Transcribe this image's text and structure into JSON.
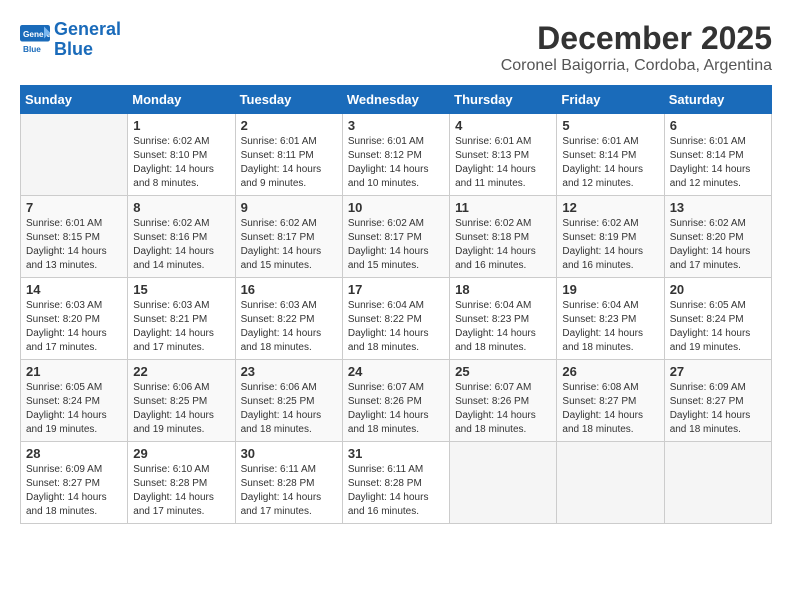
{
  "header": {
    "logo_line1": "General",
    "logo_line2": "Blue",
    "title": "December 2025",
    "subtitle": "Coronel Baigorria, Cordoba, Argentina"
  },
  "weekdays": [
    "Sunday",
    "Monday",
    "Tuesday",
    "Wednesday",
    "Thursday",
    "Friday",
    "Saturday"
  ],
  "weeks": [
    [
      {
        "day": "",
        "sunrise": "",
        "sunset": "",
        "daylight": ""
      },
      {
        "day": "1",
        "sunrise": "Sunrise: 6:02 AM",
        "sunset": "Sunset: 8:10 PM",
        "daylight": "Daylight: 14 hours and 8 minutes."
      },
      {
        "day": "2",
        "sunrise": "Sunrise: 6:01 AM",
        "sunset": "Sunset: 8:11 PM",
        "daylight": "Daylight: 14 hours and 9 minutes."
      },
      {
        "day": "3",
        "sunrise": "Sunrise: 6:01 AM",
        "sunset": "Sunset: 8:12 PM",
        "daylight": "Daylight: 14 hours and 10 minutes."
      },
      {
        "day": "4",
        "sunrise": "Sunrise: 6:01 AM",
        "sunset": "Sunset: 8:13 PM",
        "daylight": "Daylight: 14 hours and 11 minutes."
      },
      {
        "day": "5",
        "sunrise": "Sunrise: 6:01 AM",
        "sunset": "Sunset: 8:14 PM",
        "daylight": "Daylight: 14 hours and 12 minutes."
      },
      {
        "day": "6",
        "sunrise": "Sunrise: 6:01 AM",
        "sunset": "Sunset: 8:14 PM",
        "daylight": "Daylight: 14 hours and 12 minutes."
      }
    ],
    [
      {
        "day": "7",
        "sunrise": "Sunrise: 6:01 AM",
        "sunset": "Sunset: 8:15 PM",
        "daylight": "Daylight: 14 hours and 13 minutes."
      },
      {
        "day": "8",
        "sunrise": "Sunrise: 6:02 AM",
        "sunset": "Sunset: 8:16 PM",
        "daylight": "Daylight: 14 hours and 14 minutes."
      },
      {
        "day": "9",
        "sunrise": "Sunrise: 6:02 AM",
        "sunset": "Sunset: 8:17 PM",
        "daylight": "Daylight: 14 hours and 15 minutes."
      },
      {
        "day": "10",
        "sunrise": "Sunrise: 6:02 AM",
        "sunset": "Sunset: 8:17 PM",
        "daylight": "Daylight: 14 hours and 15 minutes."
      },
      {
        "day": "11",
        "sunrise": "Sunrise: 6:02 AM",
        "sunset": "Sunset: 8:18 PM",
        "daylight": "Daylight: 14 hours and 16 minutes."
      },
      {
        "day": "12",
        "sunrise": "Sunrise: 6:02 AM",
        "sunset": "Sunset: 8:19 PM",
        "daylight": "Daylight: 14 hours and 16 minutes."
      },
      {
        "day": "13",
        "sunrise": "Sunrise: 6:02 AM",
        "sunset": "Sunset: 8:20 PM",
        "daylight": "Daylight: 14 hours and 17 minutes."
      }
    ],
    [
      {
        "day": "14",
        "sunrise": "Sunrise: 6:03 AM",
        "sunset": "Sunset: 8:20 PM",
        "daylight": "Daylight: 14 hours and 17 minutes."
      },
      {
        "day": "15",
        "sunrise": "Sunrise: 6:03 AM",
        "sunset": "Sunset: 8:21 PM",
        "daylight": "Daylight: 14 hours and 17 minutes."
      },
      {
        "day": "16",
        "sunrise": "Sunrise: 6:03 AM",
        "sunset": "Sunset: 8:22 PM",
        "daylight": "Daylight: 14 hours and 18 minutes."
      },
      {
        "day": "17",
        "sunrise": "Sunrise: 6:04 AM",
        "sunset": "Sunset: 8:22 PM",
        "daylight": "Daylight: 14 hours and 18 minutes."
      },
      {
        "day": "18",
        "sunrise": "Sunrise: 6:04 AM",
        "sunset": "Sunset: 8:23 PM",
        "daylight": "Daylight: 14 hours and 18 minutes."
      },
      {
        "day": "19",
        "sunrise": "Sunrise: 6:04 AM",
        "sunset": "Sunset: 8:23 PM",
        "daylight": "Daylight: 14 hours and 18 minutes."
      },
      {
        "day": "20",
        "sunrise": "Sunrise: 6:05 AM",
        "sunset": "Sunset: 8:24 PM",
        "daylight": "Daylight: 14 hours and 19 minutes."
      }
    ],
    [
      {
        "day": "21",
        "sunrise": "Sunrise: 6:05 AM",
        "sunset": "Sunset: 8:24 PM",
        "daylight": "Daylight: 14 hours and 19 minutes."
      },
      {
        "day": "22",
        "sunrise": "Sunrise: 6:06 AM",
        "sunset": "Sunset: 8:25 PM",
        "daylight": "Daylight: 14 hours and 19 minutes."
      },
      {
        "day": "23",
        "sunrise": "Sunrise: 6:06 AM",
        "sunset": "Sunset: 8:25 PM",
        "daylight": "Daylight: 14 hours and 18 minutes."
      },
      {
        "day": "24",
        "sunrise": "Sunrise: 6:07 AM",
        "sunset": "Sunset: 8:26 PM",
        "daylight": "Daylight: 14 hours and 18 minutes."
      },
      {
        "day": "25",
        "sunrise": "Sunrise: 6:07 AM",
        "sunset": "Sunset: 8:26 PM",
        "daylight": "Daylight: 14 hours and 18 minutes."
      },
      {
        "day": "26",
        "sunrise": "Sunrise: 6:08 AM",
        "sunset": "Sunset: 8:27 PM",
        "daylight": "Daylight: 14 hours and 18 minutes."
      },
      {
        "day": "27",
        "sunrise": "Sunrise: 6:09 AM",
        "sunset": "Sunset: 8:27 PM",
        "daylight": "Daylight: 14 hours and 18 minutes."
      }
    ],
    [
      {
        "day": "28",
        "sunrise": "Sunrise: 6:09 AM",
        "sunset": "Sunset: 8:27 PM",
        "daylight": "Daylight: 14 hours and 18 minutes."
      },
      {
        "day": "29",
        "sunrise": "Sunrise: 6:10 AM",
        "sunset": "Sunset: 8:28 PM",
        "daylight": "Daylight: 14 hours and 17 minutes."
      },
      {
        "day": "30",
        "sunrise": "Sunrise: 6:11 AM",
        "sunset": "Sunset: 8:28 PM",
        "daylight": "Daylight: 14 hours and 17 minutes."
      },
      {
        "day": "31",
        "sunrise": "Sunrise: 6:11 AM",
        "sunset": "Sunset: 8:28 PM",
        "daylight": "Daylight: 14 hours and 16 minutes."
      },
      {
        "day": "",
        "sunrise": "",
        "sunset": "",
        "daylight": ""
      },
      {
        "day": "",
        "sunrise": "",
        "sunset": "",
        "daylight": ""
      },
      {
        "day": "",
        "sunrise": "",
        "sunset": "",
        "daylight": ""
      }
    ]
  ]
}
